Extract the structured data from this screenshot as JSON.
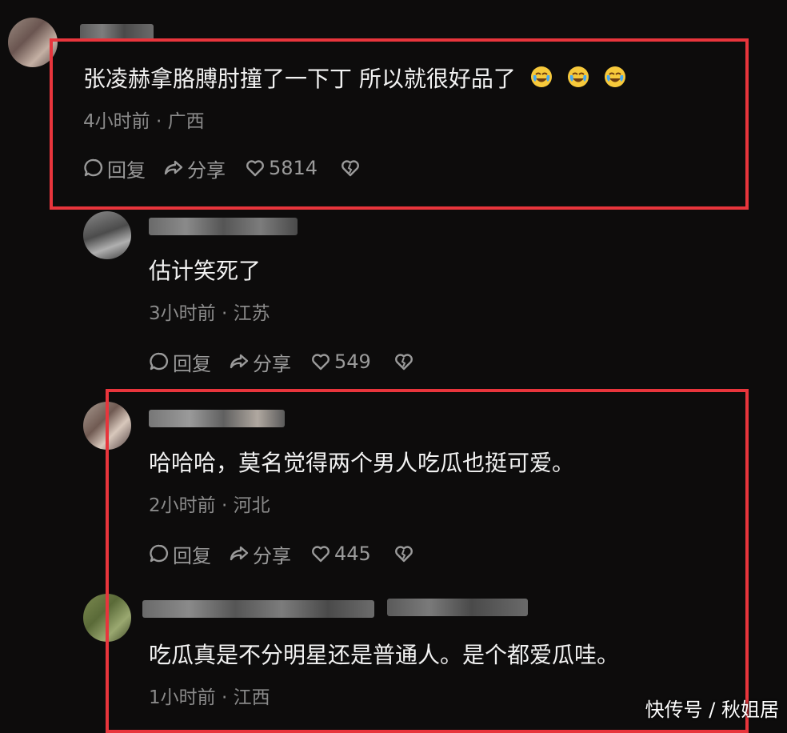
{
  "comments": [
    {
      "text": "张凌赫拿胳膊肘撞了一下丁 所以就很好品了",
      "meta": "4小时前 · 广西",
      "reply_label": "回复",
      "share_label": "分享",
      "likes": "5814",
      "emojis": [
        "crying-laugh",
        "crying-laugh",
        "crying-laugh"
      ]
    },
    {
      "text": "估计笑死了",
      "meta": "3小时前 · 江苏",
      "reply_label": "回复",
      "share_label": "分享",
      "likes": "549"
    },
    {
      "text": "哈哈哈，莫名觉得两个男人吃瓜也挺可爱。",
      "meta": "2小时前 · 河北",
      "reply_label": "回复",
      "share_label": "分享",
      "likes": "445"
    },
    {
      "text": "吃瓜真是不分明星还是普通人。是个都爱瓜哇。",
      "meta": "1小时前 · 江西"
    }
  ],
  "watermark": "快传号 / 秋姐居",
  "colors": {
    "background": "#0d0c0c",
    "highlight": "#e8353c",
    "meta_text": "#8a8a8a"
  }
}
